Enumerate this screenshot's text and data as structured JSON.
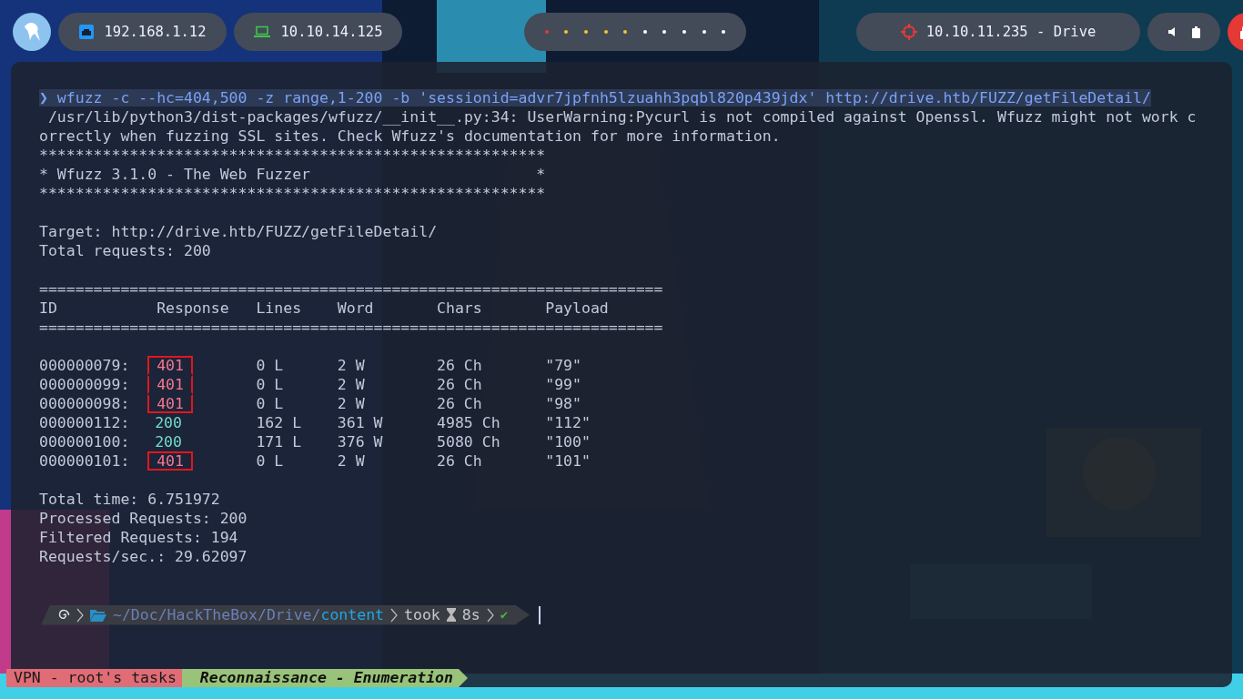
{
  "top_bar": {
    "network": [
      {
        "kind": "ethernet",
        "label": "192.168.1.12"
      },
      {
        "kind": "vpn",
        "label": "10.10.14.125"
      }
    ],
    "workspaces": [
      {
        "color": "#e53935"
      },
      {
        "color": "#fbc02d"
      },
      {
        "color": "#fbc02d"
      },
      {
        "color": "#fbc02d"
      },
      {
        "color": "#fbc02d"
      },
      {
        "color": "#ffffff"
      },
      {
        "color": "#ffffff"
      },
      {
        "color": "#ffffff"
      },
      {
        "color": "#ffffff"
      },
      {
        "color": "#ffffff"
      }
    ],
    "target": "10.10.11.235 - Drive"
  },
  "terminal": {
    "command": {
      "prompt": "❯",
      "text": "wfuzz -c --hc=404,500 -z range,1-200 -b 'sessionid=advr7jpfnh5lzuahh3pqbl820p439jdx' http://drive.htb/FUZZ/getFileDetail/"
    },
    "warning": [
      " /usr/lib/python3/dist-packages/wfuzz/__init__.py:34: UserWarning:Pycurl is not compiled against Openssl. Wfuzz might not work c",
      "orrectly when fuzzing SSL sites. Check Wfuzz's documentation for more information."
    ],
    "banner": [
      "********************************************************",
      "* Wfuzz 3.1.0 - The Web Fuzzer                         *",
      "********************************************************"
    ],
    "target_info": [
      "Target: http://drive.htb/FUZZ/getFileDetail/",
      "Total requests: 200"
    ],
    "rule": "=====================================================================",
    "columns": [
      "ID",
      "Response",
      "Lines",
      "Word",
      "Chars",
      "Payload"
    ],
    "rows": [
      {
        "id": "000000079:",
        "response": "401",
        "color": "#f7768e",
        "highlighted": true,
        "lines": "0 L",
        "word": "2 W",
        "chars": "26 Ch",
        "payload": "\"79\""
      },
      {
        "id": "000000099:",
        "response": "401",
        "color": "#f7768e",
        "highlighted": true,
        "lines": "0 L",
        "word": "2 W",
        "chars": "26 Ch",
        "payload": "\"99\""
      },
      {
        "id": "000000098:",
        "response": "401",
        "color": "#f7768e",
        "highlighted": true,
        "lines": "0 L",
        "word": "2 W",
        "chars": "26 Ch",
        "payload": "\"98\""
      },
      {
        "id": "000000112:",
        "response": "200",
        "color": "#73daca",
        "highlighted": false,
        "lines": "162 L",
        "word": "361 W",
        "chars": "4985 Ch",
        "payload": "\"112\""
      },
      {
        "id": "000000100:",
        "response": "200",
        "color": "#73daca",
        "highlighted": false,
        "lines": "171 L",
        "word": "376 W",
        "chars": "5080 Ch",
        "payload": "\"100\""
      },
      {
        "id": "000000101:",
        "response": "401",
        "color": "#f7768e",
        "highlighted": true,
        "lines": "0 L",
        "word": "2 W",
        "chars": "26 Ch",
        "payload": "\"101\""
      }
    ],
    "summary": [
      "Total time: 6.751972",
      "Processed Requests: 200",
      "Filtered Requests: 194",
      "Requests/sec.: 29.62097"
    ],
    "prompt": {
      "path": "~/Doc/HackTheBox/Drive/",
      "current_dir": "content",
      "took": "took",
      "duration": "8s",
      "status": "✔"
    },
    "status_bar": [
      {
        "kind": "session",
        "label": "VPN - root's tasks"
      },
      {
        "kind": "task",
        "label": "Reconnaissance - Enumeration"
      }
    ]
  }
}
